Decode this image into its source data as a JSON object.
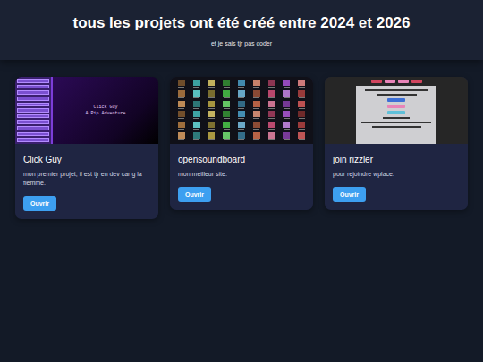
{
  "header": {
    "title": "tous les projets ont été créé entre 2024 et 2026",
    "subtitle": "et je sais tjr pas coder"
  },
  "projects": [
    {
      "title": "Click Guy",
      "description": "mon premier projet, il est tjr en dev car g la flemme.",
      "button": "Ouvrir",
      "preview": {
        "kind": "game",
        "texts": [
          "Click Guy",
          "A Pip Adventure"
        ]
      }
    },
    {
      "title": "opensoundboard",
      "description": "mon meilleur site.",
      "button": "Ouvrir",
      "preview": {
        "kind": "grid",
        "texts": []
      }
    },
    {
      "title": "join rizzler",
      "description": "pour rejoindre wplace.",
      "button": "Ouvrir",
      "preview": {
        "kind": "form",
        "texts": []
      }
    }
  ]
}
